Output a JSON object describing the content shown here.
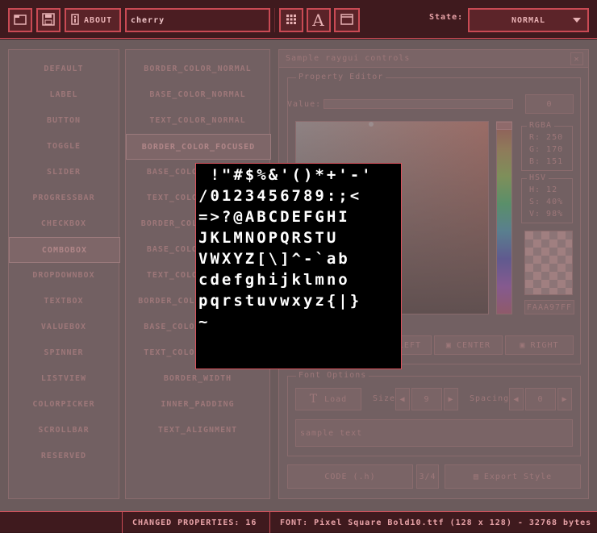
{
  "toolbar": {
    "about_label": "ABOUT",
    "font_input_value": "cherry",
    "state_label": "State:",
    "state_value": "NORMAL"
  },
  "controls_list": [
    "DEFAULT",
    "LABEL",
    "BUTTON",
    "TOGGLE",
    "SLIDER",
    "PROGRESSBAR",
    "CHECKBOX",
    "COMBOBOX",
    "DROPDOWNBOX",
    "TEXTBOX",
    "VALUEBOX",
    "SPINNER",
    "LISTVIEW",
    "COLORPICKER",
    "SCROLLBAR",
    "RESERVED"
  ],
  "properties_list": [
    "BORDER_COLOR_NORMAL",
    "BASE_COLOR_NORMAL",
    "TEXT_COLOR_NORMAL",
    "BORDER_COLOR_FOCUSED",
    "BASE_COLOR_FOCUSED",
    "TEXT_COLOR_FOCUSED",
    "BORDER_COLOR_PRESSED",
    "BASE_COLOR_PRESSED",
    "TEXT_COLOR_PRESSED",
    "BORDER_COLOR_DISABLED",
    "BASE_COLOR_DISABLED",
    "TEXT_COLOR_DISABLED",
    "BORDER_WIDTH",
    "INNER_PADDING",
    "TEXT_ALIGNMENT"
  ],
  "window": {
    "title": "Sample raygui controls",
    "property_editor": {
      "title": "Property Editor",
      "value_label": "Value:",
      "value_box": "0"
    },
    "rgba": {
      "title": "RGBA",
      "r": "R:  250",
      "g": "G:  170",
      "b": "B:  151"
    },
    "hsv": {
      "title": "HSV",
      "h": "H:  12",
      "s": "S:  40%",
      "v": "V:  98%"
    },
    "hex": "FAAA97FF",
    "align_buttons": [
      "LEFT",
      "CENTER",
      "RIGHT"
    ],
    "font_options": {
      "title": "Font Options",
      "load_label": "Load",
      "size_label": "Size",
      "size_value": "9",
      "spacing_label": "Spacing",
      "spacing_value": "0",
      "sample_text": "sample text"
    },
    "code_label": "CODE (.h)",
    "page_counter": "3/4",
    "export_label": "Export Style"
  },
  "atlas_rows": [
    " !\"#$%&'()*+'-'",
    "/0123456789:;<",
    "=>?@ABCDEFGHI",
    "JKLMNOPQRSTU",
    "VWXYZ[\\]^-`ab",
    "cdefghijklmno",
    "pqrstuvwxyz{|}",
    "~"
  ],
  "status": {
    "changed": "CHANGED PROPERTIES: 16",
    "font_info": "FONT: Pixel Square Bold10.ttf (128 x 128) - 32768 bytes"
  },
  "colors": {
    "accent": "#d9525c",
    "background": "#351619",
    "selected_color": "#faaa97"
  }
}
